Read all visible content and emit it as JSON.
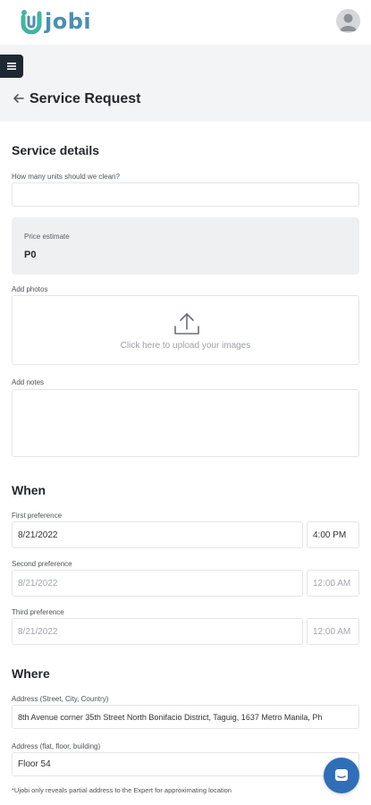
{
  "brand": {
    "logo_text": "jobi",
    "accent": "#4a8fb3",
    "logo_green": "#3fb6a0"
  },
  "header": {
    "title": "Service Request"
  },
  "service_details": {
    "heading": "Service details",
    "units_label": "How many units should we clean?",
    "units_value": "",
    "price_estimate_label": "Price estimate",
    "price_estimate_value": "P0",
    "photos_label": "Add photos",
    "upload_text": "Click here to upload your images",
    "notes_label": "Add notes",
    "notes_value": ""
  },
  "when": {
    "heading": "When",
    "preferences": [
      {
        "label": "First preference",
        "date": "8/21/2022",
        "time": "4:00 PM"
      },
      {
        "label": "Second preference",
        "date": "8/21/2022",
        "time": "12:00 AM"
      },
      {
        "label": "Third preference",
        "date": "8/21/2022",
        "time": "12:00 AM"
      }
    ]
  },
  "where": {
    "heading": "Where",
    "address_label": "Address (Street, City, Country)",
    "address_value": "8th Avenue corner 35th Street North Bonifacio District, Taguig, 1637 Metro Manila, Ph",
    "unit_label": "Address (flat, floor, building)",
    "unit_value": "Floor 54",
    "note": "*Ujobi only reveals partial address to the Expert for approximating location"
  },
  "colors": {
    "menu_button": "#1c2833",
    "chat_button": "#2f6fb8"
  }
}
